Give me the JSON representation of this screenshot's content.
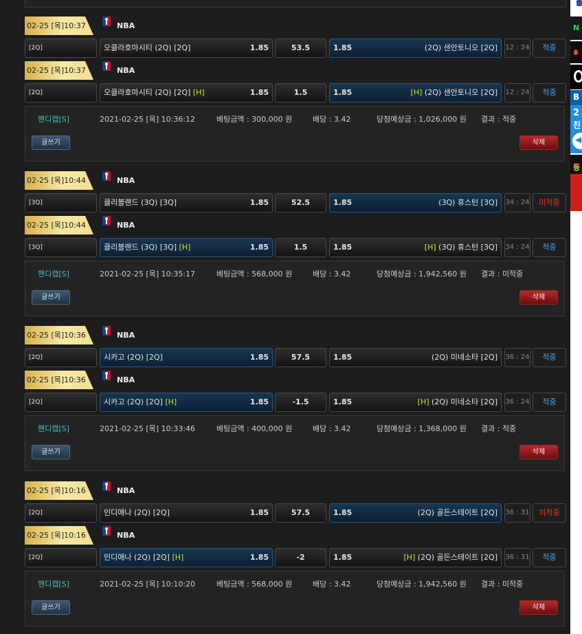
{
  "bets": [
    {
      "rows": [
        {
          "date": "02-25 [목]10:37",
          "league": "NBA",
          "period": "[2Q]",
          "home": "오클라호마시티 (2Q) [2Q]",
          "home_h": "",
          "home_odds": "1.85",
          "home_selected": false,
          "mid": "53.5",
          "away_odds": "1.85",
          "away": "(2Q) 샌안토니오 [2Q]",
          "away_h": "",
          "away_selected": true,
          "time": "12 : 24",
          "result": "적중",
          "result_type": "win"
        },
        {
          "date": "02-25 [목]10:37",
          "league": "NBA",
          "period": "[2Q]",
          "home": "오클라호마시티 (2Q) [2Q]",
          "home_h": "[H]",
          "home_odds": "1.85",
          "home_selected": false,
          "mid": "1.5",
          "away_odds": "1.85",
          "away": "(2Q) 샌안토니오 [2Q]",
          "away_h": "[H]",
          "away_selected": true,
          "time": "12 : 24",
          "result": "적중",
          "result_type": "win"
        }
      ],
      "info": {
        "type": "핸디캡[S]",
        "datetime": "2021-02-25 [목] 10:36:12",
        "amount": "베팅금액 : 300,000 원",
        "odds": "배당 : 3.42",
        "expected": "당첨예상금 : 1,026,000 원",
        "result": "결과 : 적중"
      }
    },
    {
      "rows": [
        {
          "date": "02-25 [목]10:44",
          "league": "NBA",
          "period": "[3Q]",
          "home": "클리블랜드 (3Q) [3Q]",
          "home_h": "",
          "home_odds": "1.85",
          "home_selected": false,
          "mid": "52.5",
          "away_odds": "1.85",
          "away": "(3Q) 휴스턴 [3Q]",
          "away_h": "",
          "away_selected": true,
          "time": "34 : 24",
          "result": "미적중",
          "result_type": "lose"
        },
        {
          "date": "02-25 [목]10:44",
          "league": "NBA",
          "period": "[3Q]",
          "home": "클리블랜드 (3Q) [3Q]",
          "home_h": "[H]",
          "home_odds": "1.85",
          "home_selected": true,
          "mid": "1.5",
          "away_odds": "1.85",
          "away": "(3Q) 휴스턴 [3Q]",
          "away_h": "[H]",
          "away_selected": false,
          "time": "34 : 24",
          "result": "적중",
          "result_type": "win"
        }
      ],
      "info": {
        "type": "핸디캡[S]",
        "datetime": "2021-02-25 [목] 10:35:17",
        "amount": "베팅금액 : 568,000 원",
        "odds": "배당 : 3.42",
        "expected": "당첨예상금 : 1,942,560 원",
        "result": "결과 : 미적중"
      }
    },
    {
      "rows": [
        {
          "date": "02-25 [목]10:36",
          "league": "NBA",
          "period": "[2Q]",
          "home": "시카고 (2Q) [2Q]",
          "home_h": "",
          "home_odds": "1.85",
          "home_selected": true,
          "mid": "57.5",
          "away_odds": "1.85",
          "away": "(2Q) 미네소타 [2Q]",
          "away_h": "",
          "away_selected": false,
          "time": "36 : 24",
          "result": "적중",
          "result_type": "win"
        },
        {
          "date": "02-25 [목]10:36",
          "league": "NBA",
          "period": "[2Q]",
          "home": "시카고 (2Q) [2Q]",
          "home_h": "[H]",
          "home_odds": "1.85",
          "home_selected": true,
          "mid": "-1.5",
          "away_odds": "1.85",
          "away": "(2Q) 미네소타 [2Q]",
          "away_h": "[H]",
          "away_selected": false,
          "time": "36 : 24",
          "result": "적중",
          "result_type": "win"
        }
      ],
      "info": {
        "type": "핸디캡[S]",
        "datetime": "2021-02-25 [목] 10:33:46",
        "amount": "베팅금액 : 400,000 원",
        "odds": "배당 : 3.42",
        "expected": "당첨예상금 : 1,368,000 원",
        "result": "결과 : 적중"
      }
    },
    {
      "rows": [
        {
          "date": "02-25 [목]10:16",
          "league": "NBA",
          "period": "[2Q]",
          "home": "인디애나 (2Q) [2Q]",
          "home_h": "",
          "home_odds": "1.85",
          "home_selected": false,
          "mid": "57.5",
          "away_odds": "1.85",
          "away": "(2Q) 골든스테이트 [2Q]",
          "away_h": "",
          "away_selected": true,
          "time": "36 : 31",
          "result": "미적중",
          "result_type": "lose"
        },
        {
          "date": "02-25 [목]10:16",
          "league": "NBA",
          "period": "[2Q]",
          "home": "인디애나 (2Q) [2Q]",
          "home_h": "[H]",
          "home_odds": "1.85",
          "home_selected": true,
          "mid": "-2",
          "away_odds": "1.85",
          "away": "(2Q) 골든스테이트 [2Q]",
          "away_h": "[H]",
          "away_selected": false,
          "time": "36 : 31",
          "result": "적중",
          "result_type": "win"
        }
      ],
      "info": {
        "type": "핸디캡[S]",
        "datetime": "2021-02-25 [목] 10:10:20",
        "amount": "베팅금액 : 568,000 원",
        "odds": "배당 : 3.42",
        "expected": "당첨예상금 : 1,942,560 원",
        "result": "결과 : 미적중"
      }
    }
  ],
  "buttons": {
    "write": "글쓰기",
    "delete": "삭제"
  },
  "sidebar": {
    "items": [
      "N",
      "B",
      "2",
      "친",
      "등"
    ]
  },
  "colors": {
    "win": "#4aa3e6",
    "lose": "#e03a2b",
    "handicap_type": "#4ac0c0",
    "h_flag": "#cfe23a",
    "date_badge": "#f3df92"
  }
}
